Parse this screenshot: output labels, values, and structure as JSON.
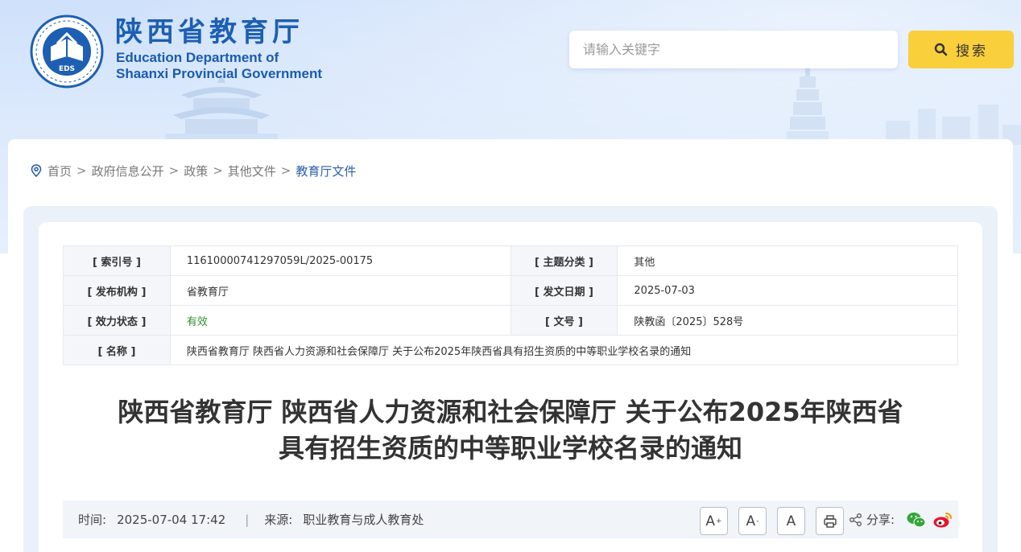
{
  "header": {
    "site_name_cn": "陕西省教育厅",
    "site_name_en_line1": "Education Department of",
    "site_name_en_line2": "Shaanxi Provincial Government",
    "emblem_text": "EDS",
    "search_placeholder": "请输入关键字",
    "search_button_label": "搜索",
    "search_button_color": "#f9cf3b"
  },
  "breadcrumb": {
    "items": [
      "首页",
      "政府信息公开",
      "政策",
      "其他文件",
      "教育厅文件"
    ],
    "separator": ">"
  },
  "meta_table": {
    "index_no_label": "[ 索引号 ]",
    "index_no": "11610000741297059L/2025-00175",
    "topic_label": "[ 主题分类 ]",
    "topic": "其他",
    "publisher_label": "[ 发布机构 ]",
    "publisher": "省教育厅",
    "issue_date_label": "[ 发文日期 ]",
    "issue_date": "2025-07-03",
    "status_label": "[ 效力状态 ]",
    "status": "有效",
    "doc_no_label": "[ 文号 ]",
    "doc_no": "陕教函〔2025〕528号",
    "name_label": "[ 名称 ]",
    "name": "陕西省教育厅 陕西省人力资源和社会保障厅 关于公布2025年陕西省具有招生资质的中等职业学校名录的通知"
  },
  "article": {
    "title_line1": "陕西省教育厅 陕西省人力资源和社会保障厅 关于公布2025年陕西省",
    "title_line2": "具有招生资质的中等职业学校名录的通知",
    "time_label": "时间:",
    "time": "2025-07-04 17:42",
    "source_label": "来源:",
    "source": "职业教育与成人教育处"
  },
  "tools": {
    "font_large": "A",
    "font_small": "A",
    "font_default": "A",
    "share_label": "分享:"
  },
  "colors": {
    "brand_blue": "#1d5fb3",
    "breadcrumb_current": "#2a5fa8",
    "valid_green": "#2f8f2f"
  }
}
